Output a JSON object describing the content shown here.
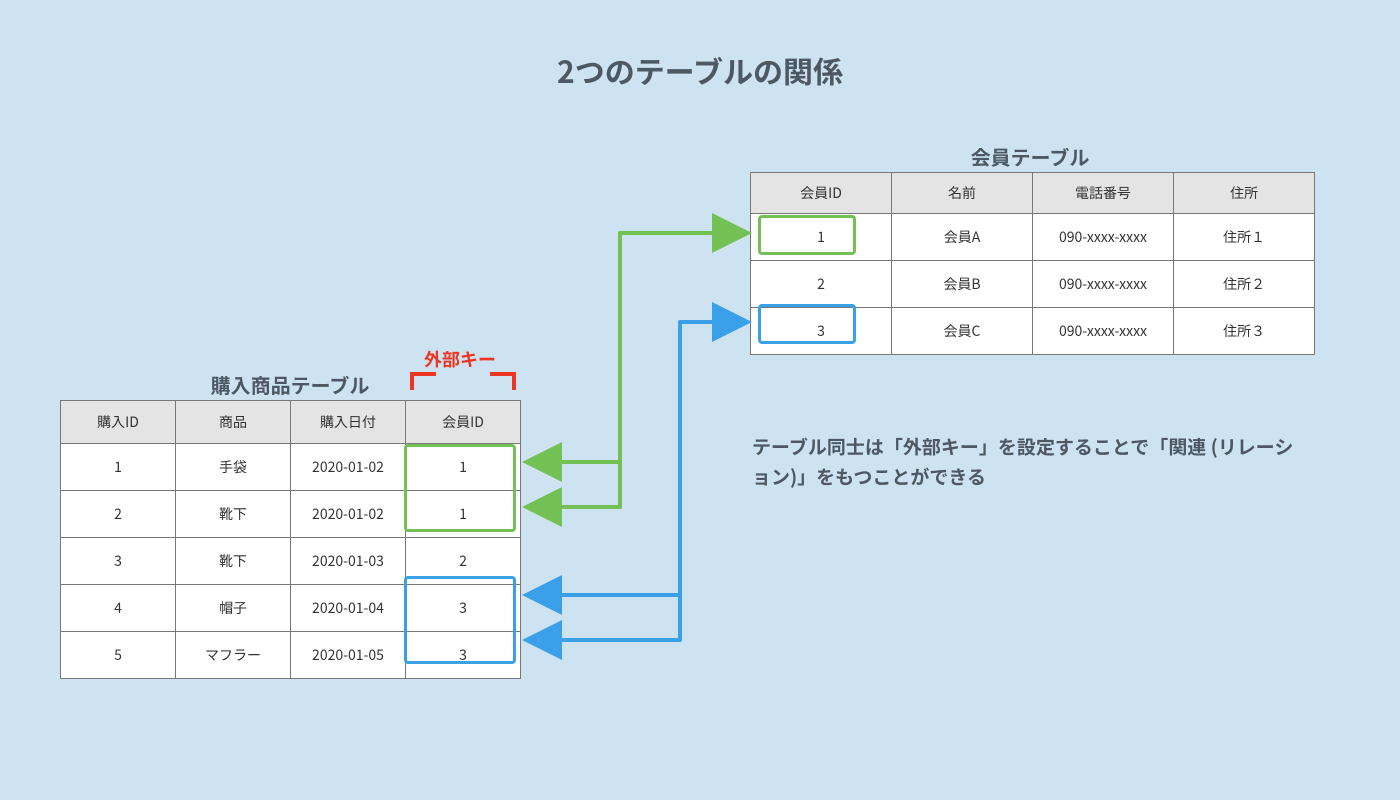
{
  "title": "2つのテーブルの関係",
  "fk_label": "外部キー",
  "description": "テーブル同士は「外部キー」を設定することで「関連 (リレーション)」をもつことができる",
  "purchase": {
    "title": "購入商品テーブル",
    "headers": [
      "購入ID",
      "商品",
      "購入日付",
      "会員ID"
    ],
    "rows": [
      [
        "1",
        "手袋",
        "2020-01-02",
        "1"
      ],
      [
        "2",
        "靴下",
        "2020-01-02",
        "1"
      ],
      [
        "3",
        "靴下",
        "2020-01-03",
        "2"
      ],
      [
        "4",
        "帽子",
        "2020-01-04",
        "3"
      ],
      [
        "5",
        "マフラー",
        "2020-01-05",
        "3"
      ]
    ]
  },
  "member": {
    "title": "会員テーブル",
    "headers": [
      "会員ID",
      "名前",
      "電話番号",
      "住所"
    ],
    "rows": [
      [
        "1",
        "会員A",
        "090-xxxx-xxxx",
        "住所１"
      ],
      [
        "2",
        "会員B",
        "090-xxxx-xxxx",
        "住所２"
      ],
      [
        "3",
        "会員C",
        "090-xxxx-xxxx",
        "住所３"
      ]
    ]
  },
  "colors": {
    "green": "#73c054",
    "blue": "#3aa0e8",
    "red": "#ee3523"
  }
}
